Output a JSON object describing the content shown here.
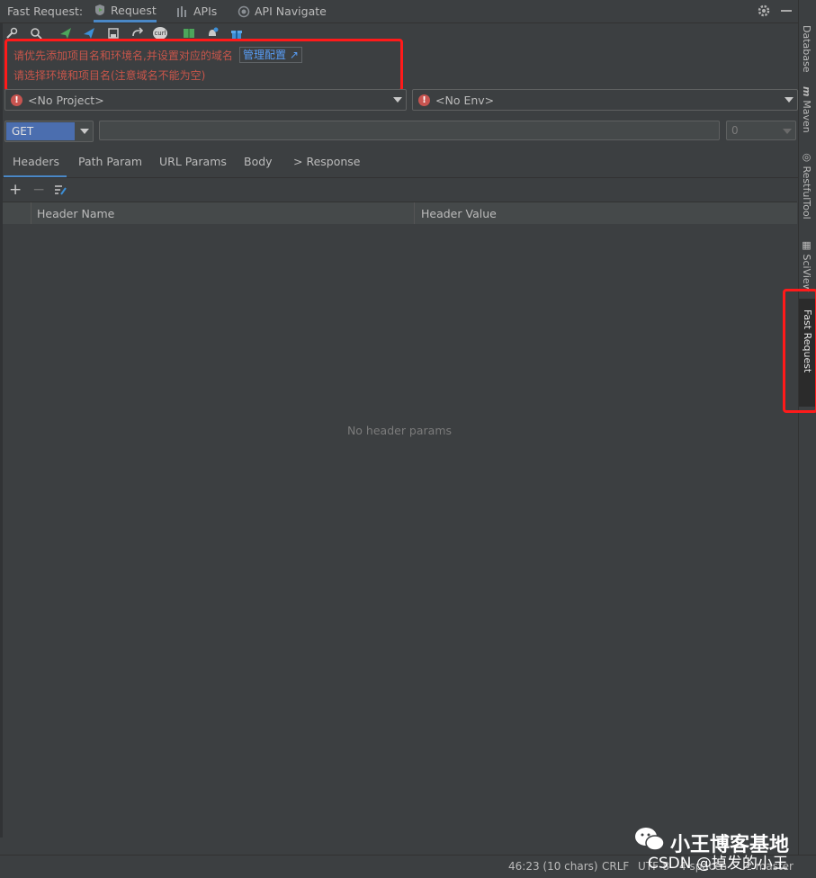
{
  "header": {
    "tool_title": "Fast Request:",
    "tabs": [
      {
        "label": "Request",
        "icon": "request-icon",
        "active": true
      },
      {
        "label": "APIs",
        "icon": "apis-icon",
        "active": false
      },
      {
        "label": "API Navigate",
        "icon": "navigate-icon",
        "active": false
      }
    ]
  },
  "toolbar": {
    "icons": [
      "wrench-icon",
      "search-icon",
      "send-icon",
      "send-debug-icon",
      "save-icon",
      "redo-icon",
      "curl-icon",
      "doc-icon",
      "notify-icon",
      "gift-icon"
    ],
    "curl_label": "curl"
  },
  "message": {
    "line1": "请优先添加项目名和环境名,并设置对应的域名",
    "link": "管理配置 ↗",
    "line2": "请选择环境和项目名(注意域名不能为空)"
  },
  "project_select": {
    "value": "<No Project>"
  },
  "env_select": {
    "value": "<No Env>"
  },
  "request": {
    "method": "GET",
    "url": "",
    "timeout": "0"
  },
  "param_tabs": [
    "Headers",
    "Path Param",
    "URL Params",
    "Body",
    "> Response"
  ],
  "table": {
    "columns": [
      "Header Name",
      "Header Value"
    ],
    "empty_text": "No header params"
  },
  "right_stripe": [
    "Database",
    "Maven",
    "RestfulTool",
    "SciView",
    "Fast Request"
  ],
  "status": {
    "position": "46:23 (10 chars)",
    "line_sep": "CRLF",
    "encoding": "UTF-8",
    "indent": "4 spaces",
    "branch": "master"
  },
  "watermark": {
    "line1": "小王博客基地",
    "line2": "CSDN @掉发的小王"
  },
  "colors": {
    "accent": "#4a88c7",
    "error": "#c7554a",
    "annotation": "#ff1a1a",
    "method_bg": "#4b6eaf"
  }
}
